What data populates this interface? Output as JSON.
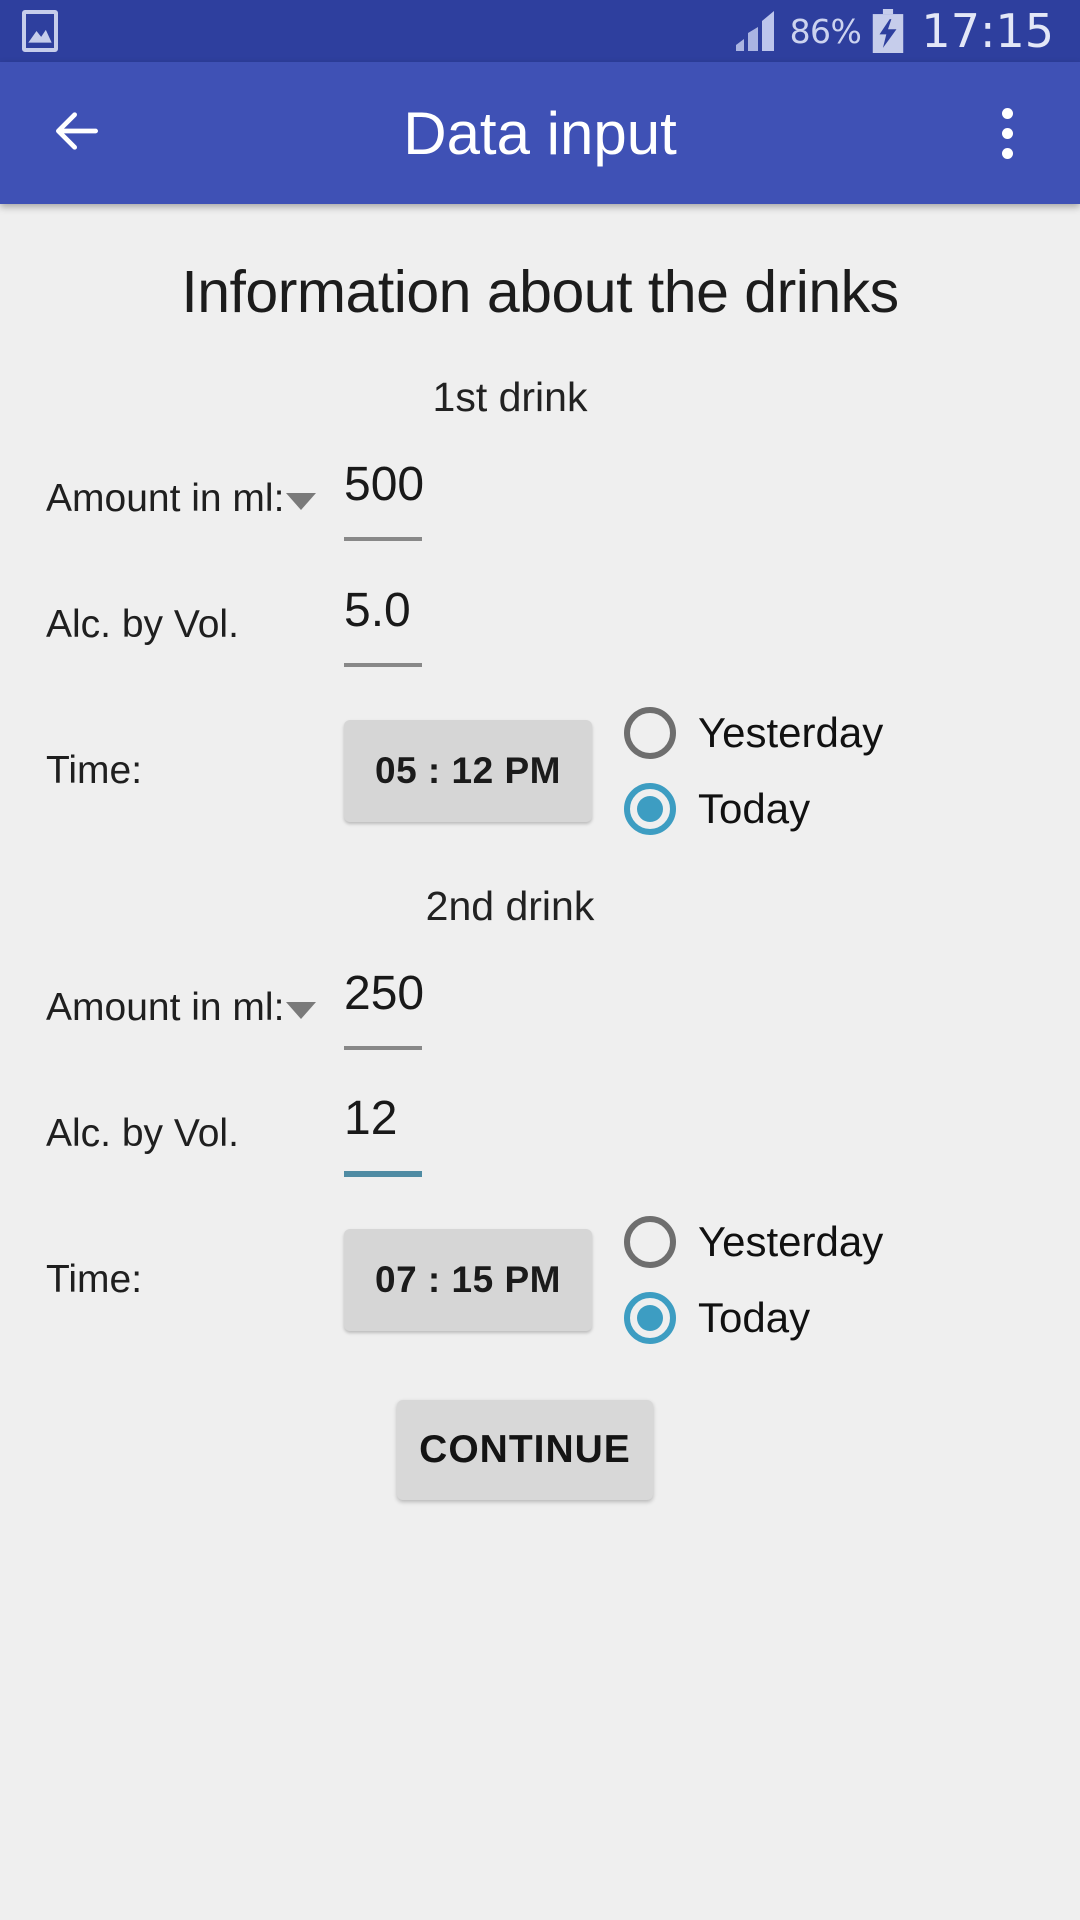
{
  "status_bar": {
    "photo_icon": "photo-icon",
    "signal_icon": "signal-icon",
    "battery_percent": "86%",
    "battery_icon": "battery-charging-icon",
    "clock": "17:15"
  },
  "app_bar": {
    "back_icon": "back-arrow-icon",
    "title": "Data input",
    "overflow_icon": "overflow-menu-icon"
  },
  "main": {
    "page_heading": "Information about the drinks",
    "drinks": [
      {
        "heading": "1st drink",
        "amount_label": "Amount in ml:",
        "amount_value": "500",
        "amount_focused": false,
        "alc_label": "Alc. by Vol.",
        "alc_value": "5.0",
        "alc_focused": false,
        "time_label": "Time:",
        "time_value": "05 : 12 PM",
        "day_options": [
          "Yesterday",
          "Today"
        ],
        "day_selected": "Today"
      },
      {
        "heading": "2nd drink",
        "amount_label": "Amount in ml:",
        "amount_value": "250",
        "amount_focused": false,
        "alc_label": "Alc. by Vol.",
        "alc_value": "12",
        "alc_focused": true,
        "time_label": "Time:",
        "time_value": "07 : 15 PM",
        "day_options": [
          "Yesterday",
          "Today"
        ],
        "day_selected": "Today"
      }
    ],
    "continue_label": "CONTINUE"
  },
  "colors": {
    "status_bar": "#2e3f9e",
    "app_bar": "#3f51b5",
    "background": "#efefef",
    "accent_radio": "#3d9dc2",
    "focused_underline": "#4f8ba3",
    "button_face": "#d6d6d6"
  }
}
